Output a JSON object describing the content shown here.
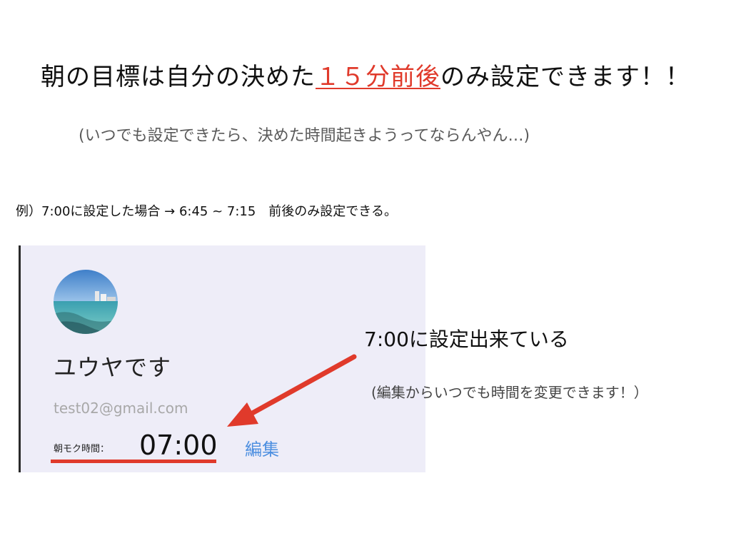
{
  "headline": {
    "before": "朝の目標は自分の決めた",
    "accent": "１５分前後",
    "after": "のみ設定できます！！"
  },
  "subnote": "(いつでも設定できたら、決めた時間起きようってならんやん…)",
  "example": "例）7:00に設定した場合 → 6:45 ~ 7:15　前後のみ設定できる。",
  "profile": {
    "avatar_icon": "beach-photo-avatar",
    "name": "ユウヤです",
    "email": "test02@gmail.com",
    "time_label": "朝モク時間：",
    "time_value": "07:00",
    "edit_label": "編集"
  },
  "callout": {
    "title": "7:00に設定出来ている",
    "note": "(編集からいつでも時間を変更できます！）"
  },
  "colors": {
    "accent": "#e03a2b",
    "link": "#4d8fe0",
    "panel_bg": "#eeedf8"
  }
}
